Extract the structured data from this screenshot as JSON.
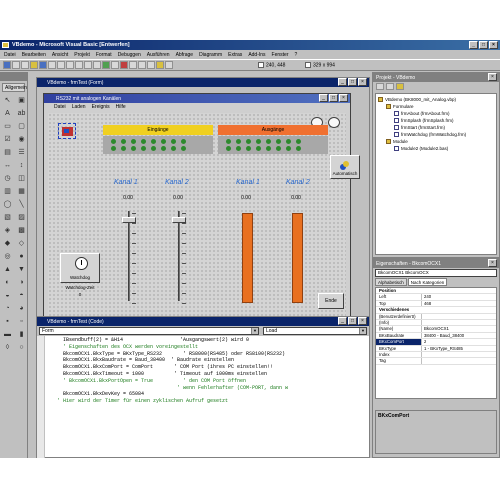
{
  "window": {
    "title": "VBdemo - Microsoft Visual Basic [Entwerfen]",
    "controls": [
      "_",
      "□",
      "×"
    ]
  },
  "menu": [
    "Datei",
    "Bearbeiten",
    "Ansicht",
    "Projekt",
    "Format",
    "Debuggen",
    "Ausführen",
    "Abfrage",
    "Diagramm",
    "Extras",
    "Add-Ins",
    "Fenster",
    "?"
  ],
  "toolbar": {
    "position_readout": "240, 448",
    "size_readout": "329 x 994"
  },
  "toolbox": {
    "title": "",
    "tab": "Allgemein",
    "tools": [
      "pointer-icon",
      "picture-icon",
      "label-icon",
      "textbox-icon",
      "frame-icon",
      "button-icon",
      "checkbox-icon",
      "option-icon",
      "combo-icon",
      "list-icon",
      "hscroll-icon",
      "vscroll-icon",
      "timer-icon",
      "drive-icon",
      "dir-icon",
      "file-icon",
      "shape-icon",
      "line-icon",
      "image-icon",
      "data-icon",
      "ole-icon",
      "grid-icon",
      "custom-icon",
      "custom2-icon",
      "custom3-icon",
      "custom4-icon",
      "custom5-icon",
      "custom6-icon",
      "custom7-icon",
      "custom8-icon",
      "custom9-icon",
      "custom10-icon",
      "custom11-icon",
      "custom12-icon",
      "custom13-icon",
      "custom14-icon",
      "custom15-icon",
      "custom16-icon",
      "custom17-icon",
      "custom18-icon"
    ]
  },
  "designer": {
    "title": "VBdemo - frmTest (Form)",
    "form": {
      "title": "RS232 mit analogen Kanälen",
      "menu": [
        "Datei",
        "Laden",
        "Ereignis",
        "Hilfe"
      ],
      "inputs_header": "Eingänge",
      "outputs_header": "Ausgänge",
      "auto_label": "Automatisch",
      "channels": [
        {
          "label": "Kanal 1",
          "value": "0.00"
        },
        {
          "label": "Kanal 2",
          "value": "0.00"
        },
        {
          "label": "Kanal 1",
          "value": "0.00"
        },
        {
          "label": "Kanal 2",
          "value": "0.00"
        }
      ],
      "watchdog_button": "Watchdog",
      "watchdog_time": "Watchdog-Zeit",
      "watchdog_value": "0",
      "end_button": "Ende"
    }
  },
  "code": {
    "title": "VBdemo - frmTest (Code)",
    "object_combo": "Form",
    "proc_combo": "Load",
    "lines": [
      "    IBsendbuff(2) = &H14                   'Ausgangswert(2) wird 0",
      "",
      "    ' Eigenschaften des OCX werden voreingestellt",
      "    BkcomOCX1.BkxType = BKxType_RS232       ' RS8000(RS485) oder RS8100(RS232)",
      "    BkcomOCX1.BkxBaudrate = Baud_38400  ' Baudrate einstellen",
      "    BkcomOCX1.BkxComPort = ComPort       ' COM Port (ihres PC einstellen!!",
      "    BkcomOCX1.BkxTimeout = 1000          ' Timeout auf 1000ms einstellen",
      "    ' BkcomOCX1.BkxPortOpen = True          ' den COM Port öffnen",
      "                                          ' wenn Fehlerhafter (COM-PORT, dann w",
      "    BkcomOCX1.BkxDevKey = 65084",
      "  ' Hier wird der Timer für einen zyklischen Aufruf gesetzt"
    ]
  },
  "project": {
    "title": "Projekt - VBdemo",
    "items": [
      {
        "label": "VBdemo (BK8000_mit_Analog.vbp)",
        "indent": 0,
        "type": "project"
      },
      {
        "label": "Formulare",
        "indent": 1,
        "type": "folder"
      },
      {
        "label": "frmAbout (frmAbout.frm)",
        "indent": 2,
        "type": "file"
      },
      {
        "label": "frmSplash (frmSplash.frm)",
        "indent": 2,
        "type": "file"
      },
      {
        "label": "frmStart (frmStart.frm)",
        "indent": 2,
        "type": "file"
      },
      {
        "label": "frmWatchdog (frmWatchdog.frm)",
        "indent": 2,
        "type": "file"
      },
      {
        "label": "Module",
        "indent": 1,
        "type": "folder"
      },
      {
        "label": "Module2 (Module2.bas)",
        "indent": 2,
        "type": "file"
      }
    ]
  },
  "properties": {
    "title": "Eigenschaften - BkcomOCX1",
    "object": "BkcomOCX1 BkcomOCX",
    "tabs": [
      "Alphabetisch",
      "Nach Kategorien"
    ],
    "rows": [
      {
        "name": "Position",
        "value": "",
        "cat": true
      },
      {
        "name": "Left",
        "value": "240"
      },
      {
        "name": "Top",
        "value": "468"
      },
      {
        "name": "Verschiedenes",
        "value": "",
        "cat": true
      },
      {
        "name": "(BenutzerdefiniertI)",
        "value": ""
      },
      {
        "name": "(Info)",
        "value": ""
      },
      {
        "name": "(Name)",
        "value": "BkcomOCX1"
      },
      {
        "name": "BKxBaudrate",
        "value": "38400 - Baud_38400"
      },
      {
        "name": "BKxComPort",
        "value": "2",
        "sel": true
      },
      {
        "name": "BKxType",
        "value": "1 - BKxType_RS485"
      },
      {
        "name": "Index",
        "value": ""
      },
      {
        "name": "Tag",
        "value": ""
      }
    ],
    "description": "BKxComPort"
  }
}
